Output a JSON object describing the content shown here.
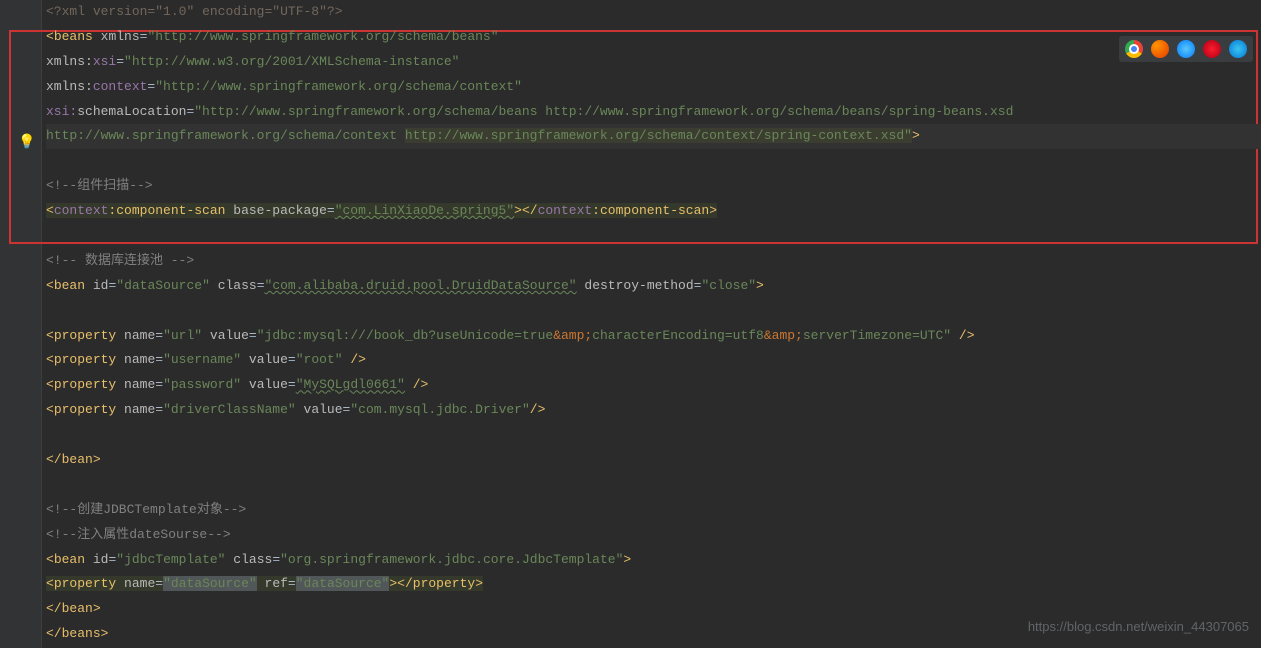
{
  "xml_decl": {
    "open": "<?xml ",
    "version_attr": "version",
    "version_val": "\"1.0\"",
    "encoding_attr": "encoding",
    "encoding_val": "\"UTF-8\"",
    "close": "?>"
  },
  "beans_open": {
    "tag": "beans",
    "xmlns_attr": "xmlns",
    "xmlns_val": "\"http://www.springframework.org/schema/beans\"",
    "xsi_ns": "xmlns:",
    "xsi_name": "xsi",
    "xsi_val": "\"http://www.w3.org/2001/XMLSchema-instance\"",
    "ctx_ns": "xmlns:",
    "ctx_name": "context",
    "ctx_val": "\"http://www.springframework.org/schema/context\"",
    "sl_ns": "xsi:",
    "sl_name": "schemaLocation",
    "sl_val_1": "\"http://www.springframework.org/schema/beans http://www.springframework.org/schema/beans/spring-beans.xsd",
    "sl_val_2a": "http://www.springframework.org/schema/context ",
    "sl_val_2b": "http://www.springframework.org/schema/context/spring-context.xsd\"",
    "gt": ">"
  },
  "comment_scan": "<!--组件扫描-->",
  "ctx_scan": {
    "open_lt": "<",
    "ns": "context",
    "colon": ":",
    "name": "component-scan",
    "attr": "base-package",
    "val": "\"com.LinXiaoDe.spring5\"",
    "gt": ">",
    "close": "</",
    "close_ns": "context",
    "close_name": "component-scan",
    "close_gt": ">"
  },
  "comment_db": "<!-- 数据库连接池 -->",
  "bean_ds": {
    "open_lt": "<",
    "tag": "bean",
    "id_attr": "id",
    "id_val": "\"dataSource\"",
    "class_attr": "class",
    "class_val": "\"com.alibaba.druid.pool.DruidDataSource\"",
    "dm_attr": "destroy-method",
    "dm_val": "\"close\"",
    "gt": ">"
  },
  "props": [
    {
      "name": "\"url\"",
      "value": "\"jdbc:mysql:///book_db?useUnicode=true",
      "amp1": "&amp;",
      "mid": "characterEncoding=utf8",
      "amp2": "&amp;",
      "tail": "serverTimezone=UTC\"",
      "end": " />"
    },
    {
      "name": "\"username\"",
      "value": "\"root\"",
      "end": " />"
    },
    {
      "name": "\"password\"",
      "value": "\"MySQLgdl0661\"",
      "end": " />"
    },
    {
      "name": "\"driverClassName\"",
      "value": "\"com.mysql.jdbc.Driver\"",
      "end": "/>"
    }
  ],
  "bean_close": "</bean>",
  "comment_jdbc1": "<!--创建JDBCTemplate对象-->",
  "comment_jdbc2": "<!--注入属性dateSourse-->",
  "bean_jt": {
    "open_lt": "<",
    "tag": "bean",
    "id_attr": "id",
    "id_val": "\"jdbcTemplate\"",
    "class_attr": "class",
    "class_val": "\"org.springframework.jdbc.core.JdbcTemplate\"",
    "gt": ">"
  },
  "prop_ds": {
    "open_lt": "<",
    "tag": "property",
    "name_attr": "name",
    "name_val": "\"dataSource\"",
    "ref_attr": "ref",
    "ref_val": "\"dataSource\"",
    "gt": ">",
    "close": "</property>"
  },
  "beans_close": "</beans>",
  "watermark": "https://blog.csdn.net/weixin_44307065",
  "icons": {
    "bulb": "💡"
  }
}
